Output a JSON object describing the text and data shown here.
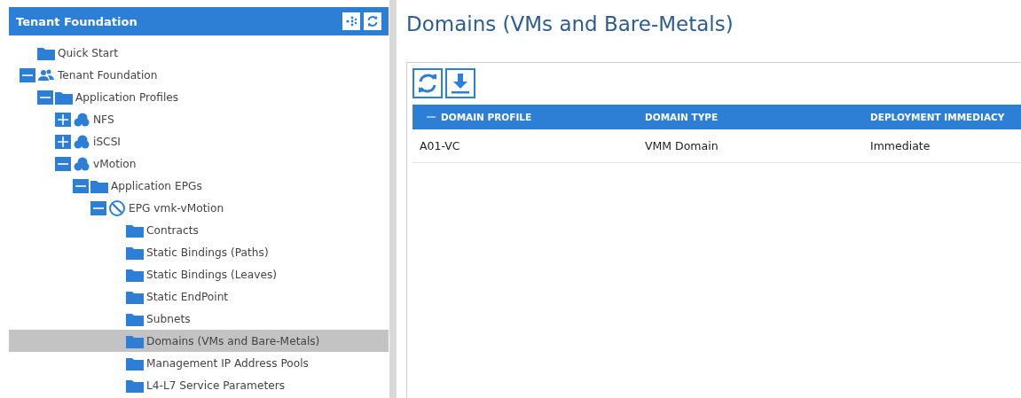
{
  "sidebar": {
    "title": "Tenant Foundation",
    "tree": [
      {
        "label": "Quick Start",
        "kind": "folder",
        "selected": false
      },
      {
        "label": "Tenant Foundation",
        "kind": "tenant",
        "expanded": true,
        "selected": false,
        "children": [
          {
            "label": "Application Profiles",
            "kind": "folder",
            "expanded": true,
            "selected": false,
            "children": [
              {
                "label": "NFS",
                "kind": "profile",
                "expanded": false,
                "selected": false
              },
              {
                "label": "iSCSI",
                "kind": "profile",
                "expanded": false,
                "selected": false
              },
              {
                "label": "vMotion",
                "kind": "profile",
                "expanded": true,
                "selected": false,
                "children": [
                  {
                    "label": "Application EPGs",
                    "kind": "folder",
                    "expanded": true,
                    "selected": false,
                    "children": [
                      {
                        "label": "EPG vmk-vMotion",
                        "kind": "epg",
                        "expanded": true,
                        "selected": false,
                        "children": [
                          {
                            "label": "Contracts",
                            "kind": "folder",
                            "selected": false
                          },
                          {
                            "label": "Static Bindings (Paths)",
                            "kind": "folder",
                            "selected": false
                          },
                          {
                            "label": "Static Bindings (Leaves)",
                            "kind": "folder",
                            "selected": false
                          },
                          {
                            "label": "Static EndPoint",
                            "kind": "folder",
                            "selected": false
                          },
                          {
                            "label": "Subnets",
                            "kind": "folder",
                            "selected": false
                          },
                          {
                            "label": "Domains (VMs and Bare-Metals)",
                            "kind": "folder",
                            "selected": true
                          },
                          {
                            "label": "Management IP Address Pools",
                            "kind": "folder",
                            "selected": false
                          },
                          {
                            "label": "L4-L7 Service Parameters",
                            "kind": "folder",
                            "selected": false
                          }
                        ]
                      }
                    ]
                  }
                ]
              }
            ]
          }
        ]
      }
    ]
  },
  "page": {
    "title": "Domains (VMs and Bare-Metals)",
    "table": {
      "columns": [
        "DOMAIN PROFILE",
        "DOMAIN TYPE",
        "DEPLOYMENT IMMEDIACY"
      ],
      "rows": [
        [
          "A01-VC",
          "VMM Domain",
          "Immediate"
        ]
      ]
    }
  }
}
